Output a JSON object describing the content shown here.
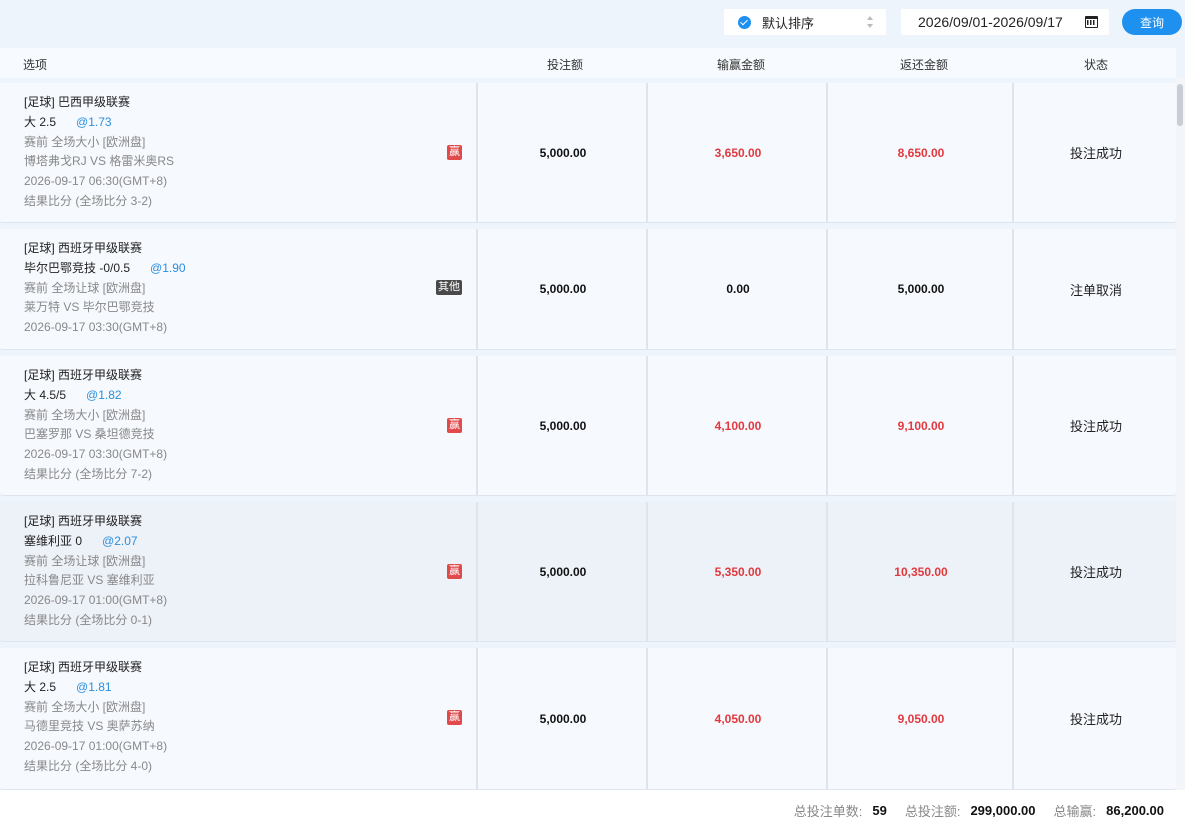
{
  "toolbar": {
    "sort_label": "默认排序",
    "date_range": "2026/09/01-2026/09/17",
    "query_label": "查询"
  },
  "header": {
    "option": "选项",
    "stake": "投注额",
    "win_loss": "输赢金额",
    "return": "返还金额",
    "status": "状态"
  },
  "rows": [
    {
      "league": "[足球] 巴西甲级联赛",
      "pick": "大 2.5",
      "odds": "@1.73",
      "market": "赛前 全场大小 [欧洲盘]",
      "teams": "博塔弗戈RJ VS 格雷米奥RS",
      "time": "2026-09-17 06:30(GMT+8)",
      "result": "结果比分 (全场比分 3-2)",
      "tag": "赢",
      "stake": "5,000.00",
      "win_loss": "3,650.00",
      "return": "8,650.00",
      "status": "投注成功"
    },
    {
      "league": "[足球] 西班牙甲级联赛",
      "pick": "毕尔巴鄂竞技 -0/0.5",
      "odds": "@1.90",
      "market": "赛前 全场让球 [欧洲盘]",
      "teams": "莱万特 VS 毕尔巴鄂竞技",
      "time": "2026-09-17 03:30(GMT+8)",
      "result": "",
      "tag": "其他",
      "stake": "5,000.00",
      "win_loss": "0.00",
      "return": "5,000.00",
      "status": "注单取消"
    },
    {
      "league": "[足球] 西班牙甲级联赛",
      "pick": "大 4.5/5",
      "odds": "@1.82",
      "market": "赛前 全场大小 [欧洲盘]",
      "teams": "巴塞罗那 VS 桑坦德竞技",
      "time": "2026-09-17 03:30(GMT+8)",
      "result": "结果比分 (全场比分 7-2)",
      "tag": "赢",
      "stake": "5,000.00",
      "win_loss": "4,100.00",
      "return": "9,100.00",
      "status": "投注成功"
    },
    {
      "league": "[足球] 西班牙甲级联赛",
      "pick": "塞维利亚 0",
      "odds": "@2.07",
      "market": "赛前 全场让球 [欧洲盘]",
      "teams": "拉科鲁尼亚 VS 塞维利亚",
      "time": "2026-09-17 01:00(GMT+8)",
      "result": "结果比分 (全场比分 0-1)",
      "tag": "赢",
      "stake": "5,000.00",
      "win_loss": "5,350.00",
      "return": "10,350.00",
      "status": "投注成功"
    },
    {
      "league": "[足球] 西班牙甲级联赛",
      "pick": "大 2.5",
      "odds": "@1.81",
      "market": "赛前 全场大小 [欧洲盘]",
      "teams": "马德里竞技 VS 奥萨苏纳",
      "time": "2026-09-17 01:00(GMT+8)",
      "result": "结果比分 (全场比分 4-0)",
      "tag": "赢",
      "stake": "5,000.00",
      "win_loss": "4,050.00",
      "return": "9,050.00",
      "status": "投注成功"
    }
  ],
  "footer": {
    "count_label": "总投注单数:",
    "count_value": "59",
    "stake_label": "总投注额:",
    "stake_value": "299,000.00",
    "win_label": "总输赢:",
    "win_value": "86,200.00"
  },
  "colors": {
    "accent": "#1e90f0",
    "win_red": "#e0393e",
    "odds_blue": "#2a8fdc"
  }
}
